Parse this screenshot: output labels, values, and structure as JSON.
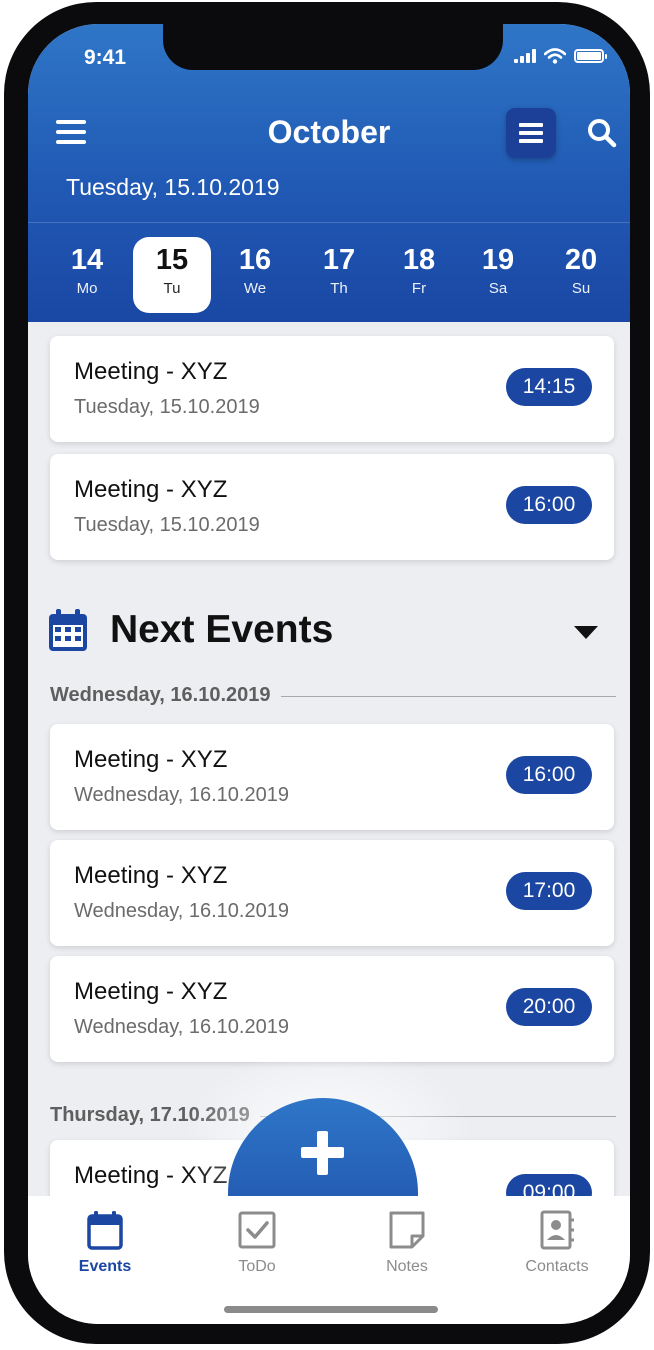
{
  "status_bar": {
    "time": "9:41"
  },
  "header": {
    "title": "October",
    "subtitle": "Tuesday, 15.10.2019"
  },
  "week": [
    {
      "num": "14",
      "dow": "Mo"
    },
    {
      "num": "15",
      "dow": "Tu",
      "selected": true
    },
    {
      "num": "16",
      "dow": "We"
    },
    {
      "num": "17",
      "dow": "Th"
    },
    {
      "num": "18",
      "dow": "Fr"
    },
    {
      "num": "19",
      "dow": "Sa"
    },
    {
      "num": "20",
      "dow": "Su"
    }
  ],
  "today_events": [
    {
      "title": "Meeting -  XYZ",
      "date": "Tuesday, 15.10.2019",
      "time": "14:15"
    },
    {
      "title": "Meeting - XYZ",
      "date": "Tuesday, 15.10.2019",
      "time": "16:00"
    }
  ],
  "next_events": {
    "title": "Next Events",
    "groups": [
      {
        "date": "Wednesday, 16.10.2019",
        "events": [
          {
            "title": "Meeting - XYZ",
            "date": "Wednesday, 16.10.2019",
            "time": "16:00"
          },
          {
            "title": "Meeting - XYZ",
            "date": "Wednesday, 16.10.2019",
            "time": "17:00"
          },
          {
            "title": "Meeting - XYZ",
            "date": "Wednesday, 16.10.2019",
            "time": "20:00"
          }
        ]
      },
      {
        "date": "Thursday, 17.10.2019",
        "events": [
          {
            "title": "Meeting - XYZ",
            "date": "",
            "time": "09:00"
          }
        ]
      }
    ]
  },
  "tabs": [
    {
      "label": "Events",
      "icon": "calendar-icon",
      "active": true
    },
    {
      "label": "ToDo",
      "icon": "checkbox-icon"
    },
    {
      "label": "Notes",
      "icon": "note-icon"
    },
    {
      "label": "Contacts",
      "icon": "contacts-icon"
    }
  ],
  "colors": {
    "brand_blue": "#1b46a2",
    "header_top": "#2f76c7",
    "background": "#eceef2"
  }
}
